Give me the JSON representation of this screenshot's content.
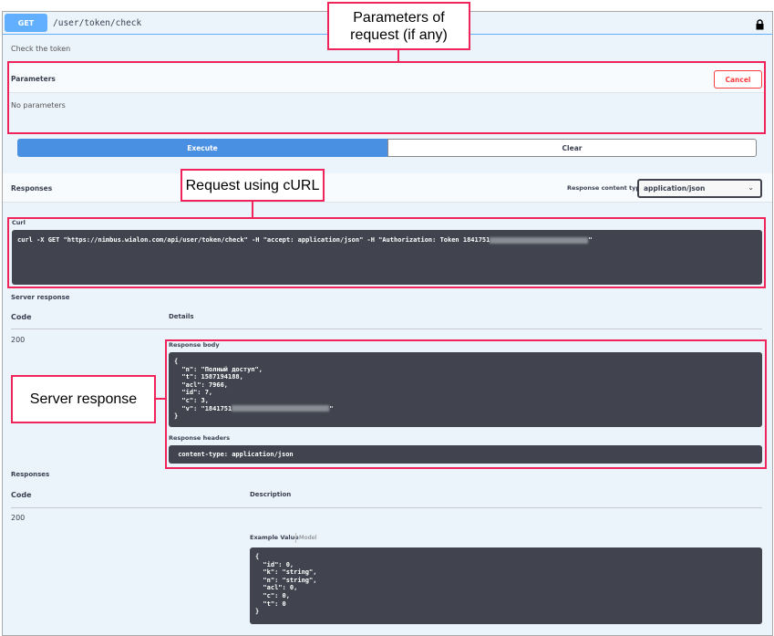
{
  "endpoint": {
    "method": "GET",
    "path": "/user/token/check",
    "description": "Check the token"
  },
  "parameters": {
    "title": "Parameters",
    "cancel_label": "Cancel",
    "empty_text": "No parameters"
  },
  "actions": {
    "execute_label": "Execute",
    "clear_label": "Clear"
  },
  "responses_header": {
    "title": "Responses",
    "content_type_label": "Response content type",
    "content_type_value": "application/json"
  },
  "curl": {
    "label": "Curl",
    "command": "curl -X GET \"https://nimbus.wialon.com/api/user/token/check\" -H \"accept: application/json\" -H \"Authorization: Token 1841751",
    "closing": "\""
  },
  "server_response": {
    "title": "Server response",
    "code_header": "Code",
    "details_header": "Details",
    "code": "200",
    "body_label": "Response body",
    "body_lines": [
      "{",
      "  \"n\": \"Полный доступ\",",
      "  \"t\": 1587194188,",
      "  \"acl\": 7966,",
      "  \"id\": 7,",
      "  \"c\": 3,"
    ],
    "body_v_prefix": "  \"v\": \"1841751",
    "body_v_suffix": "\"",
    "body_end": "}",
    "headers_label": "Response headers",
    "headers_value": " content-type: application/json "
  },
  "responses": {
    "title": "Responses",
    "code_header": "Code",
    "description_header": "Description",
    "code": "200",
    "example_tab": "Example Value",
    "model_tab": "Model",
    "example": "{\n  \"id\": 0,\n  \"k\": \"string\",\n  \"n\": \"string\",\n  \"acl\": 0,\n  \"c\": 0,\n  \"t\": 0\n}"
  },
  "annotations": {
    "params": "Parameters of request (if any)",
    "curl": "Request using cURL",
    "server": "Server response"
  },
  "colors": {
    "get": "#61affe",
    "execute": "#4990e2",
    "highlight": "#f0245a",
    "code_bg": "#41444e"
  }
}
